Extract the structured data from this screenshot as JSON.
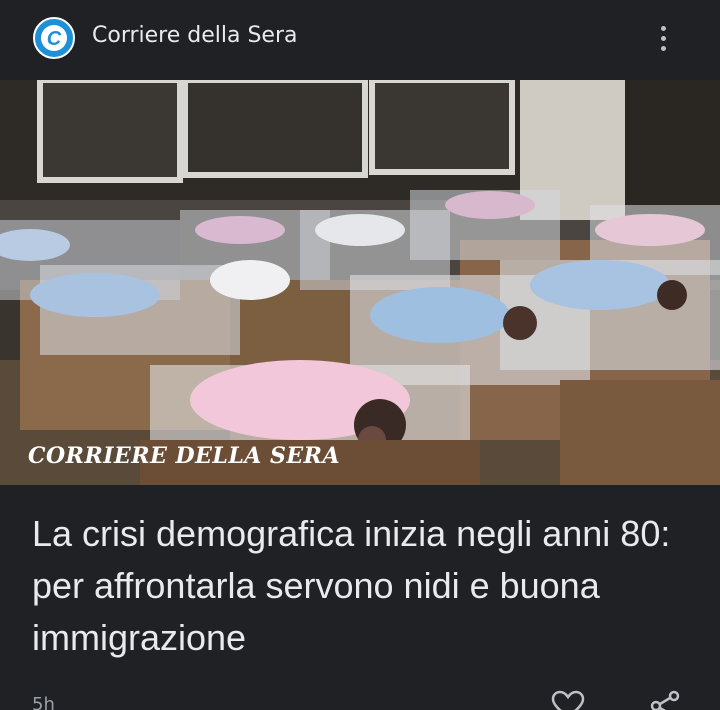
{
  "header": {
    "logo_letter": "C",
    "publisher_name": "Corriere della Sera",
    "menu_icon": "more-vert-icon"
  },
  "article": {
    "image_watermark": "CORRIERE DELLA SERA",
    "headline": "La crisi demografica inizia negli anni 80: per affrontarla servono nidi e buona immigrazione",
    "time_ago": "5h"
  },
  "actions": {
    "like_icon": "heart-icon",
    "share_icon": "share-icon"
  },
  "colors": {
    "background": "#202124",
    "logo_blue": "#1e90d8",
    "text_primary": "#e8eaed",
    "text_secondary": "#9aa0a6"
  }
}
